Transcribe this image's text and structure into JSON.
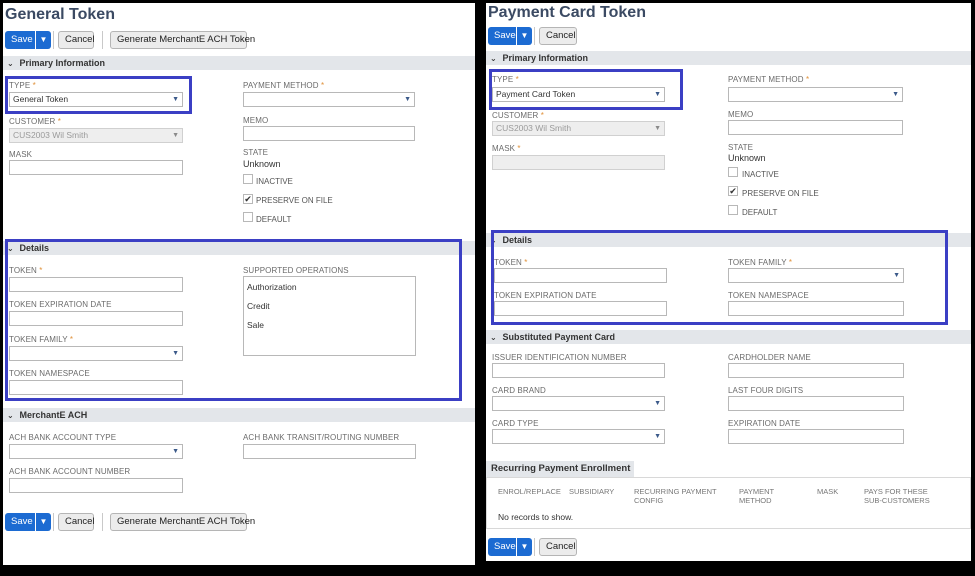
{
  "left": {
    "title": "General Token",
    "toolbar": {
      "save": "Save",
      "cancel": "Cancel",
      "generate": "Generate MerchantE ACH Token"
    },
    "primary": {
      "header": "Primary Information",
      "type_label": "TYPE",
      "type_value": "General Token",
      "payment_method_label": "PAYMENT METHOD",
      "payment_method_value": "",
      "customer_label": "CUSTOMER",
      "customer_value": "CUS2003 Wil Smith",
      "memo_label": "MEMO",
      "mask_label": "MASK",
      "state_label": "STATE",
      "state_value": "Unknown",
      "inactive_label": "INACTIVE",
      "preserve_label": "PRESERVE ON FILE",
      "default_label": "DEFAULT"
    },
    "details": {
      "header": "Details",
      "token_label": "TOKEN",
      "supported_ops_label": "SUPPORTED OPERATIONS",
      "supported_ops": [
        "Authorization",
        "Credit",
        "Sale"
      ],
      "expiration_label": "TOKEN EXPIRATION DATE",
      "family_label": "TOKEN FAMILY",
      "namespace_label": "TOKEN NAMESPACE"
    },
    "ach": {
      "header": "MerchantE ACH",
      "account_type_label": "ACH BANK ACCOUNT TYPE",
      "routing_label": "ACH BANK TRANSIT/ROUTING NUMBER",
      "account_number_label": "ACH BANK ACCOUNT NUMBER"
    },
    "bottom_toolbar": {
      "save": "Save",
      "cancel": "Cancel",
      "generate": "Generate MerchantE ACH Token"
    }
  },
  "right": {
    "title": "Payment Card Token",
    "toolbar": {
      "save": "Save",
      "cancel": "Cancel"
    },
    "primary": {
      "header": "Primary Information",
      "type_label": "TYPE",
      "type_value": "Payment Card Token",
      "payment_method_label": "PAYMENT METHOD",
      "customer_label": "CUSTOMER",
      "customer_value": "CUS2003 Wil Smith",
      "memo_label": "MEMO",
      "mask_label": "MASK",
      "state_label": "STATE",
      "state_value": "Unknown",
      "inactive_label": "INACTIVE",
      "preserve_label": "PRESERVE ON FILE",
      "default_label": "DEFAULT"
    },
    "details": {
      "header": "Details",
      "token_label": "TOKEN",
      "family_label": "TOKEN FAMILY",
      "expiration_label": "TOKEN EXPIRATION DATE",
      "namespace_label": "TOKEN NAMESPACE"
    },
    "substituted": {
      "header": "Substituted Payment Card",
      "iin_label": "ISSUER IDENTIFICATION NUMBER",
      "cardholder_label": "CARDHOLDER NAME",
      "brand_label": "CARD BRAND",
      "last_four_label": "LAST FOUR DIGITS",
      "card_type_label": "CARD TYPE",
      "expiration_label": "EXPIRATION DATE"
    },
    "recurring": {
      "header": "Recurring Payment Enrollment",
      "columns": [
        "ENROL/REPLACE",
        "SUBSIDIARY",
        "RECURRING PAYMENT CONFIG",
        "PAYMENT METHOD",
        "MASK",
        "PAYS FOR THESE SUB-CUSTOMERS"
      ],
      "empty": "No records to show."
    },
    "bottom_toolbar": {
      "save": "Save",
      "cancel": "Cancel"
    }
  },
  "symbols": {
    "required": "*",
    "dropdown_arrow": "▼",
    "chevron": "⌄",
    "checkmark": "✔"
  }
}
